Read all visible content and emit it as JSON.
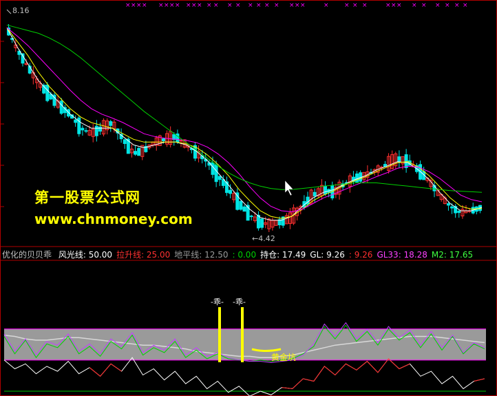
{
  "colors": {
    "background": "#000000",
    "frame": "#b00000",
    "candle_up": "#ff3030",
    "candle_down": "#00e5e5",
    "ma_fast": "#ffffff",
    "ma_mid": "#ffff00",
    "ma_slow": "#ff00ff",
    "ma_long": "#00d000",
    "signal_marks": "#ff00ff",
    "band_fill": "#9a9a9a",
    "band_edge": "#ff00ff",
    "baseline": "#00c800",
    "marker": "#ffff00"
  },
  "watermark": {
    "title": "第一股票公式网",
    "url": "www.chnmoney.com"
  },
  "indicator_header": {
    "name": "优化的贝贝乖",
    "items": [
      {
        "label": "风光线:",
        "value": "50.00",
        "color": "#ffffff"
      },
      {
        "label": "拉升线:",
        "value": "25.00",
        "color": "#ff3030"
      },
      {
        "label": "地平线:",
        "value": "12.50",
        "color": "#9a9a9a"
      },
      {
        "label": ":",
        "value": "0.00",
        "color": "#00d000"
      },
      {
        "label": "持仓:",
        "value": "17.49",
        "color": "#ffffff"
      },
      {
        "label": "GL:",
        "value": "9.26",
        "color": "#ffffff"
      },
      {
        "label": ":",
        "value": "9.26",
        "color": "#ff3030"
      },
      {
        "label": "GL33:",
        "value": "18.28",
        "color": "#ff40ff"
      },
      {
        "label": "M2:",
        "value": "17.65",
        "color": "#40ff40"
      }
    ]
  },
  "chart_data": [
    {
      "type": "candlestick",
      "annotations": [
        {
          "text": "8.16",
          "kind": "high_marker"
        },
        {
          "text": "←4.42",
          "kind": "low_marker"
        }
      ],
      "close_path": [
        8.0,
        7.6,
        7.3,
        7.0,
        6.8,
        6.6,
        6.45,
        6.2,
        6.1,
        6.2,
        6.3,
        6.0,
        5.75,
        5.8,
        5.95,
        6.0,
        6.05,
        5.9,
        5.75,
        5.6,
        5.35,
        5.1,
        4.85,
        4.65,
        4.5,
        4.48,
        4.52,
        4.6,
        4.8,
        5.0,
        5.1,
        5.05,
        5.2,
        5.3,
        5.35,
        5.45,
        5.55,
        5.65,
        5.6,
        5.45,
        5.25,
        5.0,
        4.8,
        4.68,
        4.72,
        4.78
      ],
      "series": [
        {
          "name": "ma_fast",
          "values": [
            8.0,
            7.65,
            7.35,
            7.05,
            6.85,
            6.65,
            6.45,
            6.3,
            6.2,
            6.2,
            6.2,
            6.05,
            5.9,
            5.85,
            5.9,
            5.95,
            5.95,
            5.9,
            5.78,
            5.62,
            5.4,
            5.18,
            4.95,
            4.75,
            4.6,
            4.55,
            4.55,
            4.62,
            4.8,
            4.95,
            5.05,
            5.1,
            5.2,
            5.28,
            5.35,
            5.45,
            5.52,
            5.6,
            5.58,
            5.45,
            5.28,
            5.05,
            4.85,
            4.72,
            4.72,
            4.78
          ]
        },
        {
          "name": "ma_mid",
          "values": [
            8.0,
            7.75,
            7.5,
            7.2,
            6.95,
            6.75,
            6.55,
            6.4,
            6.3,
            6.25,
            6.2,
            6.1,
            6.0,
            5.95,
            5.95,
            5.95,
            5.95,
            5.92,
            5.85,
            5.72,
            5.55,
            5.35,
            5.1,
            4.9,
            4.72,
            4.62,
            4.58,
            4.62,
            4.75,
            4.9,
            5.0,
            5.08,
            5.18,
            5.26,
            5.33,
            5.42,
            5.5,
            5.58,
            5.6,
            5.5,
            5.35,
            5.15,
            4.95,
            4.8,
            4.75,
            4.76
          ]
        },
        {
          "name": "ma_slow",
          "values": [
            8.0,
            7.85,
            7.68,
            7.48,
            7.28,
            7.08,
            6.88,
            6.7,
            6.55,
            6.45,
            6.38,
            6.3,
            6.2,
            6.1,
            6.05,
            6.02,
            6.0,
            5.98,
            5.94,
            5.86,
            5.74,
            5.58,
            5.38,
            5.15,
            4.95,
            4.8,
            4.72,
            4.7,
            4.75,
            4.85,
            4.95,
            5.02,
            5.1,
            5.18,
            5.25,
            5.33,
            5.4,
            5.48,
            5.52,
            5.5,
            5.42,
            5.3,
            5.15,
            5.0,
            4.92,
            4.88
          ]
        },
        {
          "name": "ma_long",
          "values": [
            8.05,
            8.0,
            7.95,
            7.9,
            7.82,
            7.72,
            7.6,
            7.46,
            7.3,
            7.14,
            6.98,
            6.82,
            6.66,
            6.5,
            6.36,
            6.22,
            6.08,
            5.94,
            5.8,
            5.66,
            5.52,
            5.4,
            5.3,
            5.22,
            5.16,
            5.12,
            5.1,
            5.1,
            5.12,
            5.14,
            5.16,
            5.18,
            5.2,
            5.22,
            5.22,
            5.22,
            5.2,
            5.18,
            5.16,
            5.14,
            5.12,
            5.1,
            5.08,
            5.07,
            5.06,
            5.05
          ]
        }
      ]
    },
    {
      "type": "line",
      "annotations": [
        {
          "text": "-乖-"
        },
        {
          "text": "-乖-"
        },
        {
          "text": "黄金坑"
        }
      ],
      "band": [
        25,
        50
      ],
      "ylim": [
        0,
        62
      ],
      "baseline": 0,
      "series": [
        {
          "name": "band_mid",
          "values": [
            45,
            44,
            42,
            41,
            41,
            42,
            43,
            43,
            42,
            41,
            40,
            39,
            38,
            37,
            37,
            36,
            35,
            34,
            32,
            31,
            30,
            29,
            28,
            28,
            27,
            27,
            28,
            29,
            31,
            33,
            35,
            37,
            38,
            39,
            40,
            41,
            42,
            43,
            44,
            44,
            44,
            43,
            42,
            41,
            40,
            39
          ]
        },
        {
          "name": "green",
          "values": [
            44,
            30,
            41,
            27,
            38,
            35,
            44,
            30,
            36,
            28,
            40,
            34,
            45,
            29,
            35,
            31,
            40,
            27,
            33,
            26,
            30,
            26,
            25,
            24,
            25,
            24,
            25,
            26,
            30,
            36,
            52,
            42,
            53,
            40,
            48,
            37,
            50,
            41,
            47,
            35,
            46,
            33,
            44,
            30,
            38,
            34
          ]
        },
        {
          "name": "purple",
          "values": [
            46,
            32,
            42,
            29,
            40,
            37,
            46,
            32,
            38,
            30,
            42,
            36,
            47,
            31,
            37,
            33,
            42,
            29,
            35,
            28,
            31,
            27,
            25,
            24,
            24,
            23,
            24,
            25,
            29,
            38,
            54,
            44,
            55,
            42,
            50,
            39,
            52,
            43,
            49,
            37,
            48,
            35,
            45,
            31,
            39,
            35
          ]
        },
        {
          "name": "white",
          "values": [
            25,
            18,
            22,
            14,
            20,
            16,
            24,
            14,
            19,
            12,
            22,
            16,
            27,
            13,
            18,
            9,
            16,
            6,
            12,
            2,
            8,
            -1,
            4,
            -4,
            0,
            -3,
            3,
            2,
            10,
            8,
            20,
            13,
            22,
            17,
            24,
            15,
            26,
            18,
            22,
            12,
            16,
            6,
            12,
            2,
            8,
            10
          ]
        },
        {
          "name": "red_segments",
          "values": [
            null,
            null,
            null,
            null,
            null,
            null,
            null,
            null,
            19,
            12,
            22,
            16,
            null,
            null,
            null,
            null,
            null,
            null,
            null,
            null,
            null,
            null,
            null,
            null,
            null,
            null,
            3,
            2,
            10,
            8,
            20,
            13,
            22,
            17,
            24,
            15,
            26,
            18,
            22,
            null,
            null,
            null,
            null,
            null,
            8,
            10
          ]
        }
      ]
    }
  ]
}
